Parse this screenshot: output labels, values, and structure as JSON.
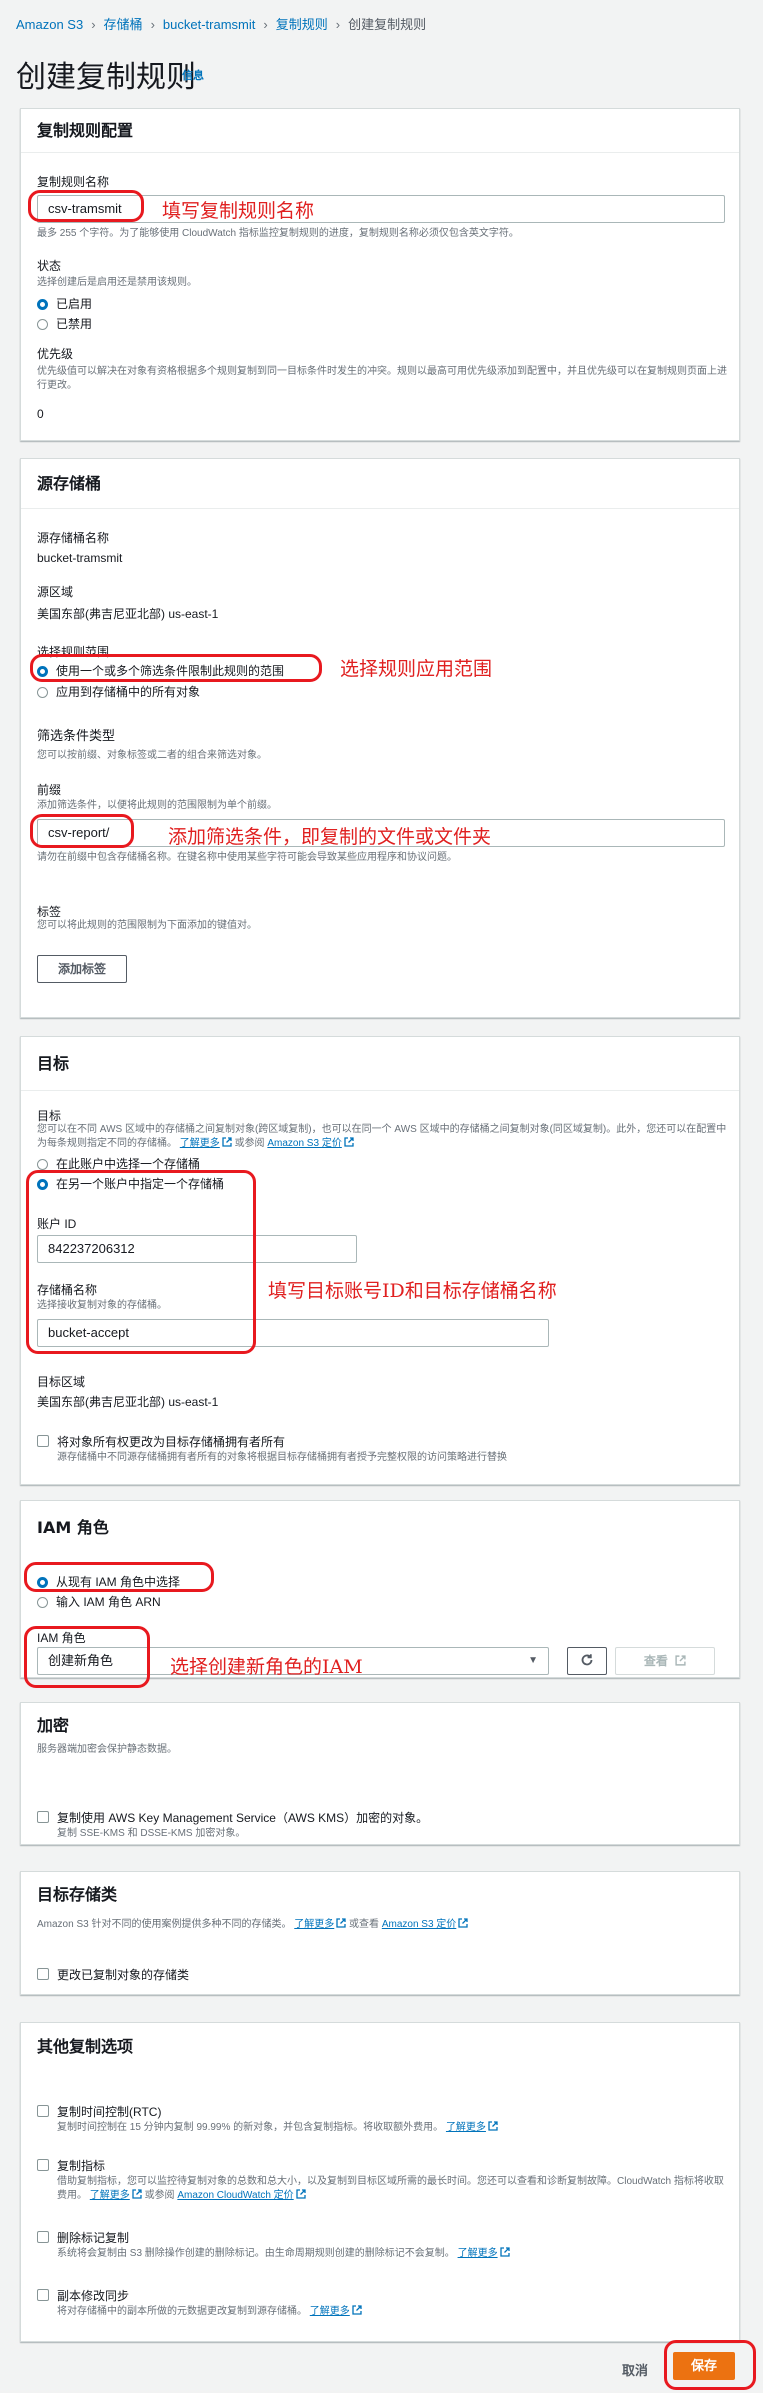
{
  "breadcrumb": [
    "Amazon S3",
    "存储桶",
    "bucket-tramsmit",
    "复制规则",
    "创建复制规则"
  ],
  "title": "创建复制规则",
  "info": "信息",
  "rule_config": {
    "header": "复制规则配置",
    "name_label": "复制规则名称",
    "name_value": "csv-tramsmit",
    "name_hint": "最多 255 个字符。为了能够使用 CloudWatch 指标监控复制规则的进度，复制规则名称必须仅包含英文字符。",
    "status_label": "状态",
    "status_desc": "选择创建后是启用还是禁用该规则。",
    "status_options": [
      "已启用",
      "已禁用"
    ],
    "priority_label": "优先级",
    "priority_desc": "优先级值可以解决在对象有资格根据多个规则复制到同一目标条件时发生的冲突。规则以最高可用优先级添加到配置中，并且优先级可以在复制规则页面上进行更改。",
    "priority_value": "0"
  },
  "source": {
    "header": "源存储桶",
    "bucket_label": "源存储桶名称",
    "bucket_value": "bucket-tramsmit",
    "region_label": "源区域",
    "region_value": "美国东部(弗吉尼亚北部) us-east-1",
    "scope_label": "选择规则范围",
    "scope_options": [
      "使用一个或多个筛选条件限制此规则的范围",
      "应用到存储桶中的所有对象"
    ],
    "filter_type_label": "筛选条件类型",
    "filter_type_desc": "您可以按前缀、对象标签或二者的组合来筛选对象。",
    "prefix_label": "前缀",
    "prefix_desc": "添加筛选条件，以便将此规则的范围限制为单个前缀。",
    "prefix_value": "csv-report/",
    "prefix_hint": "请勿在前缀中包含存储桶名称。在键名称中使用某些字符可能会导致某些应用程序和协议问题。",
    "tags_label": "标签",
    "tags_desc": "您可以将此规则的范围限制为下面添加的键值对。",
    "add_tag_button": "添加标签"
  },
  "destination": {
    "header": "目标",
    "label": "目标",
    "desc": "您可以在不同 AWS 区域中的存储桶之间复制对象(跨区域复制)，也可以在同一个 AWS 区域中的存储桶之间复制对象(同区域复制)。此外，您还可以在配置中为每条规则指定不同的存储桶。",
    "learn_more": "了解更多",
    "or_view": "或参阅",
    "pricing": "Amazon S3 定价",
    "options": [
      "在此账户中选择一个存储桶",
      "在另一个账户中指定一个存储桶"
    ],
    "account_label": "账户 ID",
    "account_value": "842237206312",
    "bucket_label": "存储桶名称",
    "bucket_desc": "选择接收复制对象的存储桶。",
    "bucket_value": "bucket-accept",
    "region_label": "目标区域",
    "region_value": "美国东部(弗吉尼亚北部) us-east-1",
    "owner_label": "将对象所有权更改为目标存储桶拥有者所有",
    "owner_desc": "源存储桶中不同源存储桶拥有者所有的对象将根据目标存储桶拥有者授予完整权限的访问策略进行替换"
  },
  "iam": {
    "header": "IAM 角色",
    "options": [
      "从现有 IAM 角色中选择",
      "输入 IAM 角色 ARN"
    ],
    "role_label": "IAM 角色",
    "role_value": "创建新角色",
    "view_button": "查看"
  },
  "encryption": {
    "header": "加密",
    "desc": "服务器端加密会保护静态数据。",
    "check_label": "复制使用 AWS Key Management Service（AWS KMS）加密的对象。",
    "check_desc": "复制 SSE-KMS 和 DSSE-KMS 加密对象。"
  },
  "storage_class": {
    "header": "目标存储类",
    "desc": "Amazon S3 针对不同的使用案例提供多种不同的存储类。",
    "learn_more": "了解更多",
    "or_view": "或查看",
    "pricing": "Amazon S3 定价",
    "check_label": "更改已复制对象的存储类"
  },
  "other": {
    "header": "其他复制选项",
    "items": [
      {
        "label": "复制时间控制(RTC)",
        "desc": "复制时间控制在 15 分钟内复制 99.99% 的新对象，并包含复制指标。将收取额外费用。",
        "link": "了解更多",
        "link2": "",
        "mid": ""
      },
      {
        "label": "复制指标",
        "desc": "借助复制指标，您可以监控待复制对象的总数和总大小，以及复制到目标区域所需的最长时间。您还可以查看和诊断复制故障。CloudWatch 指标将收取费用。",
        "link": "了解更多",
        "mid": "或参阅",
        "link2": "Amazon CloudWatch 定价"
      },
      {
        "label": "删除标记复制",
        "desc": "系统将会复制由 S3 删除操作创建的删除标记。由生命周期规则创建的删除标记不会复制。",
        "link": "了解更多",
        "link2": "",
        "mid": ""
      },
      {
        "label": "副本修改同步",
        "desc": "将对存储桶中的副本所做的元数据更改复制到源存储桶。",
        "link": "了解更多",
        "link2": "",
        "mid": ""
      }
    ]
  },
  "footer": {
    "cancel": "取消",
    "save": "保存"
  },
  "annotations": {
    "name": "填写复制规则名称",
    "scope": "选择规则应用范围",
    "prefix": "添加筛选条件，即复制的文件或文件夹",
    "dest": "填写目标账号ID和目标存储桶名称",
    "iam": "选择创建新角色的IAM"
  }
}
